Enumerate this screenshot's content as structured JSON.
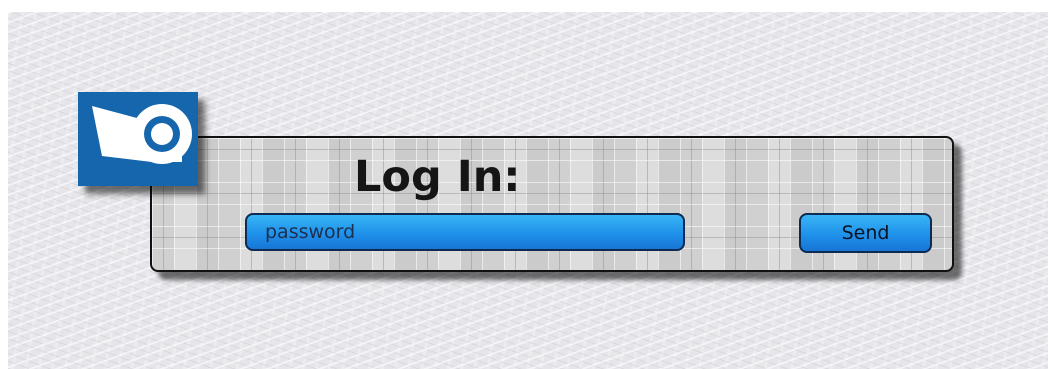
{
  "login": {
    "title": "Log In:",
    "password_placeholder": "password",
    "send_label": "Send"
  },
  "logo": {
    "icon": "brand-logo-icon",
    "color": "#1566ad"
  },
  "colors": {
    "input_fill": "#1f91ea",
    "input_border": "#0c2a52",
    "panel_border": "#111111"
  }
}
